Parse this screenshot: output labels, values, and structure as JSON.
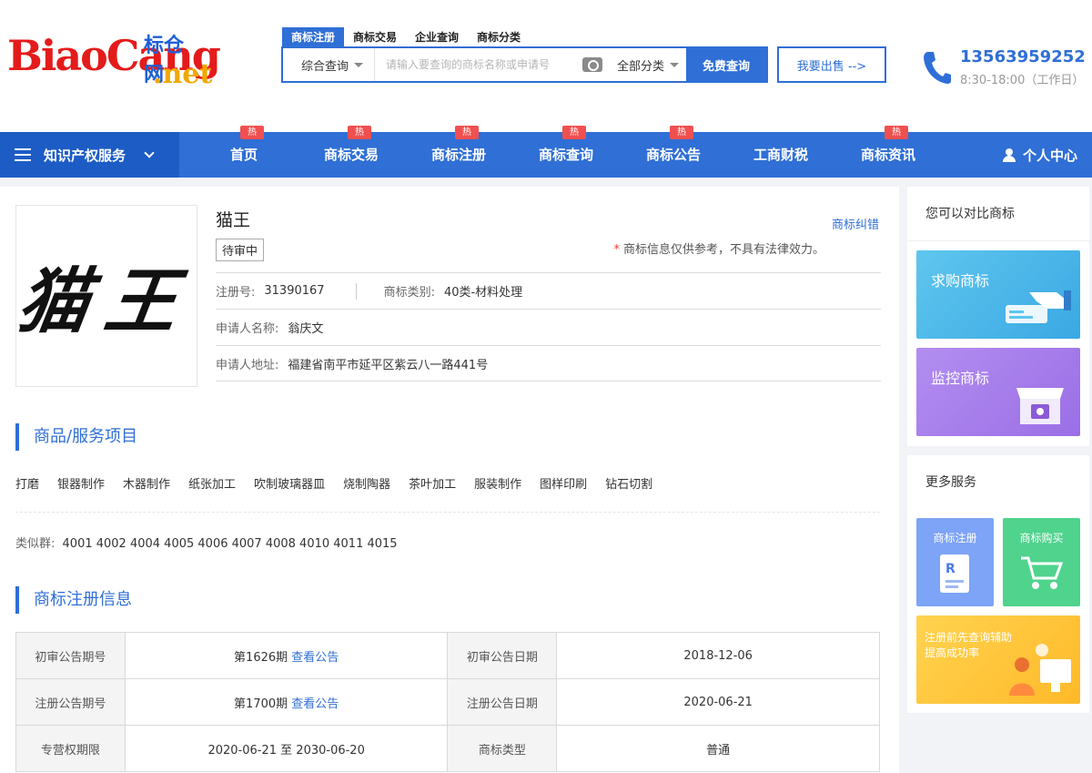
{
  "logo": {
    "en": "BiaoCang",
    "cn": "标仓网",
    "net": ".net"
  },
  "search": {
    "tabs": [
      "商标注册",
      "商标交易",
      "企业查询",
      "商标分类"
    ],
    "type_select": "综合查询",
    "placeholder": "请输入要查询的商标名称或申请号",
    "category_select": "全部分类",
    "submit_label": "免费查询"
  },
  "sell_button": "我要出售 -->",
  "contact": {
    "phone": "13563959252",
    "hours": "8:30-18:00（工作日）"
  },
  "nav": {
    "ip_services": "知识产权服务",
    "items": [
      {
        "label": "首页",
        "hot": "热"
      },
      {
        "label": "商标交易",
        "hot": "热"
      },
      {
        "label": "商标注册",
        "hot": "热"
      },
      {
        "label": "商标查询",
        "hot": "热"
      },
      {
        "label": "商标公告",
        "hot": "热"
      },
      {
        "label": "工商财税",
        "hot": ""
      },
      {
        "label": "商标资讯",
        "hot": "热"
      }
    ],
    "user_center": "个人中心"
  },
  "trademark": {
    "image_text": "猫王",
    "name": "猫王",
    "status": "待审中",
    "report_link": "商标纠错",
    "note_star": "*",
    "note": "商标信息仅供参考，不具有法律效力。",
    "reg_no_label": "注册号:",
    "reg_no": "31390167",
    "class_label": "商标类别:",
    "class_value": "40类-材料处理",
    "applicant_label": "申请人名称:",
    "applicant": "翁庆文",
    "address_label": "申请人地址:",
    "address": "福建省南平市延平区紫云八一路441号"
  },
  "goods_section": {
    "title": "商品/服务项目",
    "items": [
      "打磨",
      "银器制作",
      "木器制作",
      "纸张加工",
      "吹制玻璃器皿",
      "烧制陶器",
      "茶叶加工",
      "服装制作",
      "图样印刷",
      "钻石切割"
    ],
    "similar_label": "类似群:",
    "similar_groups": "4001 4002 4004 4005 4006 4007 4008 4010 4011 4015"
  },
  "reg_section": {
    "title": "商标注册信息",
    "rows": [
      {
        "h1": "初审公告期号",
        "v1": "第1626期",
        "link1": "查看公告",
        "h2": "初审公告日期",
        "v2": "2018-12-06"
      },
      {
        "h1": "注册公告期号",
        "v1": "第1700期",
        "link1": "查看公告",
        "h2": "注册公告日期",
        "v2": "2020-06-21"
      },
      {
        "h1": "专营权期限",
        "v1": "2020-06-21 至 2030-06-20",
        "link1": "",
        "h2": "商标类型",
        "v2": "普通"
      }
    ]
  },
  "sidebar": {
    "compare_title": "您可以对比商标",
    "buy_card": "求购商标",
    "watch_card": "监控商标",
    "more_title": "更多服务",
    "reg_card": "商标注册",
    "shop_card": "商标购买",
    "pre_card": "注册前先查询辅助提高成功率"
  },
  "colors": {
    "primary": "#2f6fd6",
    "hot_badge": "#f0504f",
    "logo_red": "#e41b1b"
  }
}
